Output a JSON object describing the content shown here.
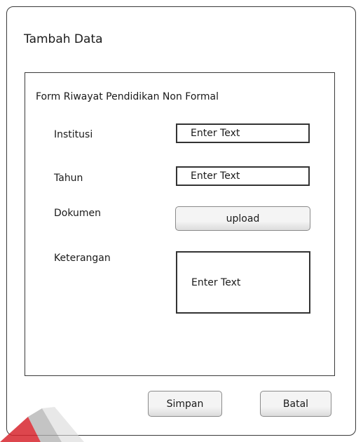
{
  "window": {
    "title": "Tambah Data"
  },
  "form": {
    "title": "Form Riwayat Pendidikan Non Formal",
    "fields": [
      {
        "label": "Institusi",
        "placeholder": "Enter Text"
      },
      {
        "label": "Tahun",
        "placeholder": "Enter Text"
      },
      {
        "label": "Dokumen",
        "button_label": "upload"
      },
      {
        "label": "Keterangan",
        "placeholder": "Enter Text"
      }
    ]
  },
  "actions": {
    "save_label": "Simpan",
    "cancel_label": "Batal"
  },
  "colors": {
    "border": "#333333",
    "button_bg": "#f4f4f4",
    "watermark_red": "#d7262e",
    "watermark_gray": "#b0b0b0"
  }
}
